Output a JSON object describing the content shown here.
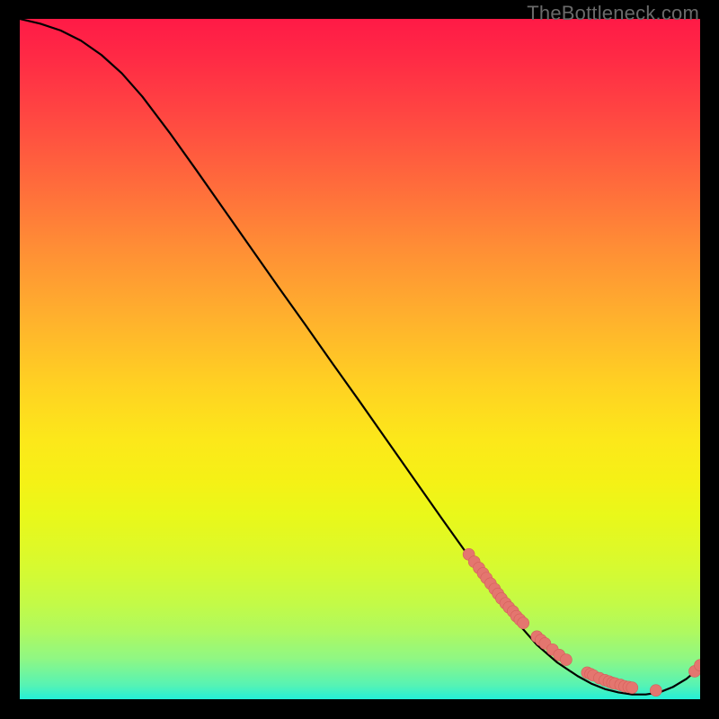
{
  "watermark": "TheBottleneck.com",
  "colors": {
    "line": "#000000",
    "marker_fill": "#e4766f",
    "marker_stroke": "#d45f5a",
    "background_black": "#000000"
  },
  "chart_data": {
    "type": "line",
    "title": "",
    "xlabel": "",
    "ylabel": "",
    "xlim": [
      0,
      100
    ],
    "ylim": [
      0,
      100
    ],
    "grid": false,
    "legend": false,
    "series": [
      {
        "name": "curve",
        "style": "line",
        "x": [
          0,
          3,
          6,
          9,
          12,
          15,
          18,
          22,
          26,
          30,
          34,
          38,
          42,
          46,
          50,
          54,
          58,
          62,
          66,
          70,
          73,
          76,
          79,
          82,
          84,
          86,
          88,
          90,
          92,
          94,
          96,
          98,
          100
        ],
        "y": [
          100,
          99.3,
          98.3,
          96.8,
          94.7,
          92.0,
          88.6,
          83.3,
          77.7,
          72.0,
          66.3,
          60.6,
          55.0,
          49.3,
          43.7,
          38.0,
          32.3,
          26.6,
          21.0,
          15.4,
          11.4,
          8.0,
          5.4,
          3.4,
          2.3,
          1.5,
          1.0,
          0.7,
          0.7,
          1.0,
          1.8,
          3.0,
          4.7
        ]
      },
      {
        "name": "points",
        "style": "scatter",
        "x": [
          66.0,
          66.8,
          67.5,
          68.1,
          68.6,
          69.2,
          69.8,
          70.3,
          70.8,
          71.4,
          71.9,
          72.5,
          73.0,
          73.5,
          74.0,
          76.0,
          76.6,
          77.2,
          78.3,
          79.3,
          80.3,
          83.4,
          83.9,
          84.3,
          85.2,
          86.0,
          86.6,
          87.1,
          87.5,
          88.3,
          88.9,
          89.5,
          90.0,
          93.5,
          99.2,
          100.0
        ],
        "y": [
          21.3,
          20.2,
          19.3,
          18.5,
          17.8,
          17.0,
          16.2,
          15.5,
          14.8,
          14.1,
          13.5,
          12.9,
          12.2,
          11.7,
          11.2,
          9.2,
          8.7,
          8.2,
          7.3,
          6.5,
          5.8,
          3.9,
          3.7,
          3.5,
          3.1,
          2.8,
          2.6,
          2.4,
          2.3,
          2.1,
          1.9,
          1.8,
          1.7,
          1.3,
          4.1,
          5.0
        ]
      }
    ]
  }
}
